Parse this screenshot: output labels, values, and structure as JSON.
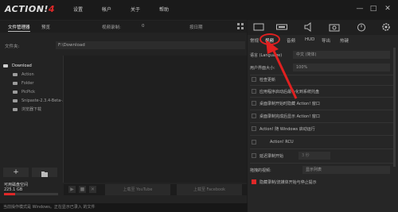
{
  "app": {
    "logo_main": "ACTION!",
    "logo_num": "4",
    "menu": [
      "设置",
      "帐户",
      "关于",
      "帮助"
    ]
  },
  "left": {
    "tabs": [
      "文件管理器",
      "预览"
    ],
    "recordings_label": "视频录制:",
    "recordings_count": "0",
    "sort_label": "按日期",
    "path_label": "文件夹:",
    "path_value": "F:\\Download",
    "tree": [
      {
        "label": "Download",
        "selected": true
      },
      {
        "label": "Action",
        "selected": false
      },
      {
        "label": "Folder",
        "selected": false
      },
      {
        "label": "PicPick",
        "selected": false
      },
      {
        "label": "Snipaste-2.3.4-Beta-...",
        "selected": false
      },
      {
        "label": "浏览器下载",
        "selected": false
      }
    ],
    "add_label": "+",
    "space_label": "可用磁盘空间",
    "space_value": "225.1 GB",
    "space_fraction": 0.2,
    "upload_buttons": [
      "上载至 YouTube",
      "上载至 Facebook"
    ],
    "status_text": "当前操作模式是 Windows。正在显示已录入 的文件"
  },
  "right": {
    "settings_tabs": [
      "常规",
      "视频",
      "音频",
      "HUD",
      "导出",
      "热键"
    ],
    "active_tab": "视频",
    "language_label": "语言 (Language)",
    "language_value": "中文 (简体)",
    "ui_size_label": "用户界面大小:",
    "ui_size_value": "100%",
    "checks": [
      {
        "label": "检查更新",
        "checked": false
      },
      {
        "label": "应用程序启动后最小化到系统托盘",
        "checked": false
      },
      {
        "label": "桌面录制开始时隐藏 Action! 窗口",
        "checked": false
      },
      {
        "label": "桌面录制完成后显示 Action! 窗口",
        "checked": false
      },
      {
        "label": "Action! 随 Windows 启动运行",
        "checked": false
      },
      {
        "label": "Action! RCU",
        "checked": false
      },
      {
        "label": "延迟录制开始",
        "checked": false
      }
    ],
    "delay_value": "3 秒",
    "drag_label": "拖拽的视频:",
    "drag_value": "显示列表",
    "hide_label": "隐藏录制/流媒体开始与停止提示",
    "hide_checked": true
  },
  "colors": {
    "accent": "#e02828",
    "bg": "#1c1c1c"
  }
}
